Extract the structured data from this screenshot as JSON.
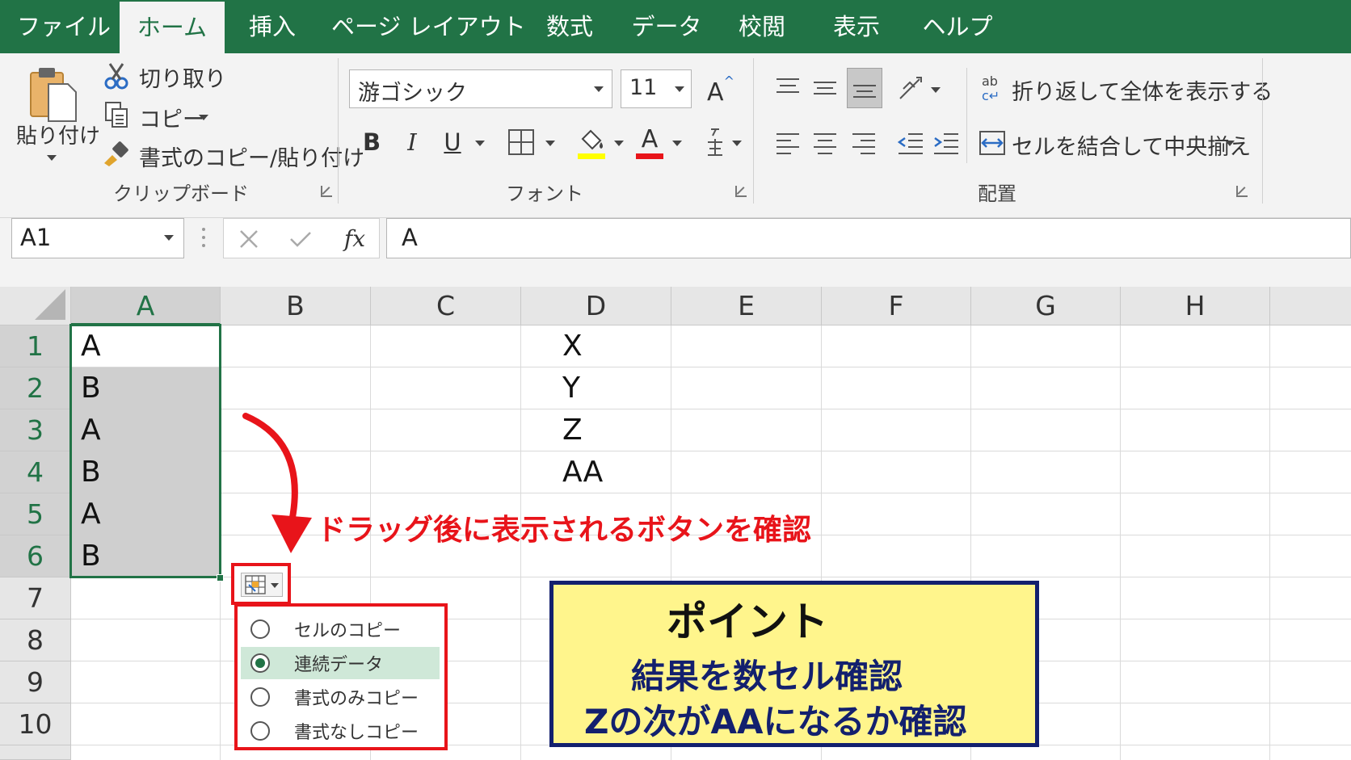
{
  "tabs": [
    "ファイル",
    "ホーム",
    "挿入",
    "ページ レイアウト",
    "数式",
    "データ",
    "校閲",
    "表示",
    "ヘルプ"
  ],
  "active_tab": "ホーム",
  "ribbon": {
    "clipboard": {
      "paste": "貼り付け",
      "cut": "切り取り",
      "copy": "コピー",
      "format_painter": "書式のコピー/貼り付け",
      "group_label": "クリップボード"
    },
    "font": {
      "font_name": "游ゴシック",
      "font_size": "11",
      "bold": "B",
      "italic": "I",
      "underline": "U",
      "font_color_letter": "A",
      "grow_font": "A",
      "group_label": "フォント"
    },
    "alignment": {
      "wrap_text": "折り返して全体を表示する",
      "merge_center": "セルを結合して中央揃え",
      "group_label": "配置"
    }
  },
  "formula_bar": {
    "name_box": "A1",
    "fx": "fx",
    "formula": "A"
  },
  "columns": [
    "A",
    "B",
    "C",
    "D",
    "E",
    "F",
    "G",
    "H"
  ],
  "rows": [
    "1",
    "2",
    "3",
    "4",
    "5",
    "6",
    "7",
    "8",
    "9",
    "10"
  ],
  "cells": {
    "A1": "A",
    "A2": "B",
    "A3": "A",
    "A4": "B",
    "A5": "A",
    "A6": "B",
    "D1": "X",
    "D2": "Y",
    "D3": "Z",
    "D4": "AA"
  },
  "autofill_menu": {
    "options": [
      "セルのコピー",
      "連続データ",
      "書式のみコピー",
      "書式なしコピー"
    ],
    "selected": "連続データ"
  },
  "annotation": {
    "arrow_text": "ドラッグ後に表示されるボタンを確認",
    "point_title": "ポイント",
    "point_line1": "結果を数セル確認",
    "point_line2": "Zの次がAAになるか確認"
  },
  "colors": {
    "excel_green": "#217346",
    "annotation_red": "#e8141a",
    "point_box_bg": "#fff58c",
    "point_box_border": "#13206e",
    "selection_fill": "#cfcfcf"
  },
  "icons": [
    "paste-icon",
    "scissors-icon",
    "copy-icon",
    "format-painter-icon",
    "grow-font-icon",
    "borders-icon",
    "fill-color-icon",
    "font-color-icon",
    "phonetic-icon",
    "align-top-icon",
    "align-middle-icon",
    "align-bottom-icon",
    "orientation-icon",
    "align-left-icon",
    "align-center-icon",
    "align-right-icon",
    "decrease-indent-icon",
    "increase-indent-icon",
    "wrap-text-icon",
    "merge-center-icon",
    "autofill-options-icon",
    "cancel-icon",
    "enter-icon"
  ]
}
